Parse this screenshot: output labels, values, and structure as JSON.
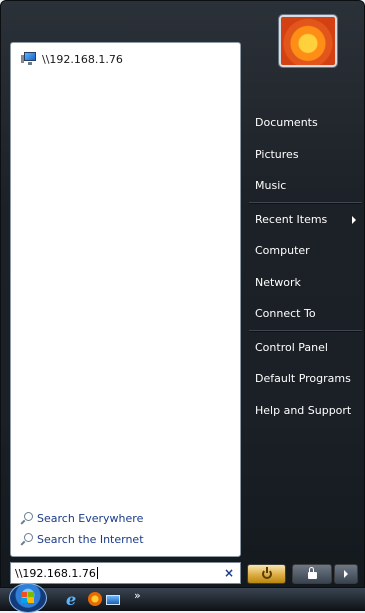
{
  "left_pane": {
    "recent_programs": [
      {
        "label": "\\\\192.168.1.76",
        "icon": "network-computer-icon"
      }
    ],
    "search_links": [
      {
        "label": "Search Everywhere",
        "icon": "search-icon"
      },
      {
        "label": "Search the Internet",
        "icon": "search-icon"
      }
    ]
  },
  "right_pane": {
    "groups": [
      [
        "Documents",
        "Pictures",
        "Music"
      ],
      [
        "Recent Items",
        "Computer",
        "Network",
        "Connect To"
      ],
      [
        "Control Panel",
        "Default Programs",
        "Help and Support"
      ]
    ],
    "submenu_item": "Recent Items"
  },
  "search_box": {
    "value": "\\\\192.168.1.76",
    "clear_glyph": "×"
  },
  "taskbar": {
    "overflow_glyph": "»",
    "quick_launch": [
      "internet-explorer-icon",
      "firefox-icon",
      "show-desktop-icon"
    ]
  },
  "colors": {
    "menu_bg": "#1c2127",
    "menu_text": "#ffffff",
    "link_text": "#1a3a8a",
    "power_button": "#e0b14a"
  }
}
